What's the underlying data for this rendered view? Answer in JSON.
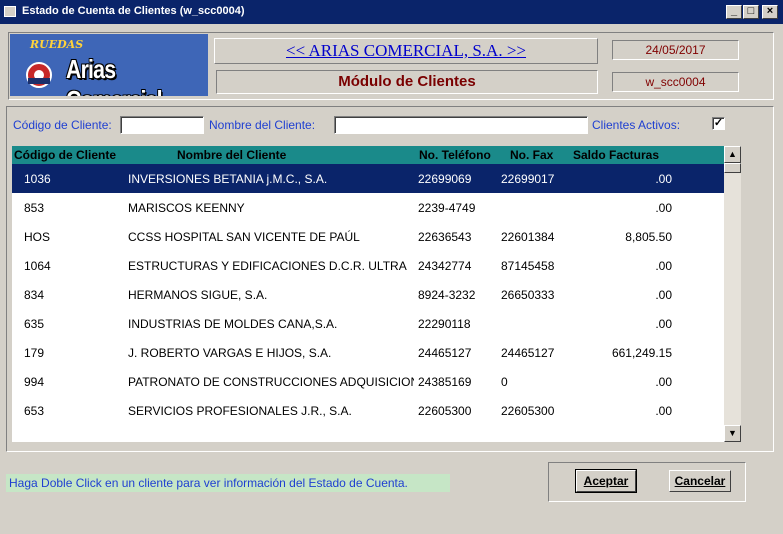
{
  "window": {
    "title": "Estado de Cuenta de Clientes  (w_scc0004)"
  },
  "banner": {
    "logo_top": "RUEDAS",
    "logo_main": "Arias Comercial",
    "company": "<< ARIAS COMERCIAL, S.A. >>",
    "module": "Módulo de Clientes",
    "date": "24/05/2017",
    "window_code": "w_scc0004"
  },
  "filters": {
    "code_label": "Código de Cliente:",
    "code_value": "",
    "name_label": "Nombre del Cliente:",
    "name_value": "",
    "active_label": "Clientes Activos:",
    "active_checked": "✓"
  },
  "grid": {
    "headers": [
      "Código de Cliente",
      "Nombre del Cliente",
      "No. Teléfono",
      "No. Fax",
      "Saldo Facturas"
    ],
    "rows": [
      {
        "code": "1036",
        "name": "INVERSIONES BETANIA j.M.C., S.A.",
        "tel": "22699069",
        "fax": "22699017",
        "saldo": ".00"
      },
      {
        "code": "853",
        "name": " MARISCOS KEENNY",
        "tel": "2239-4749",
        "fax": "",
        "saldo": ".00"
      },
      {
        "code": "HOS",
        "name": "CCSS HOSPITAL SAN VICENTE DE PAÚL",
        "tel": "22636543",
        "fax": "22601384",
        "saldo": "8,805.50"
      },
      {
        "code": "1064",
        "name": "ESTRUCTURAS Y EDIFICACIONES D.C.R. ULTRA",
        "tel": "24342774",
        "fax": "87145458",
        "saldo": ".00"
      },
      {
        "code": "834",
        "name": "HERMANOS SIGUE, S.A.",
        "tel": "8924-3232",
        "fax": "26650333",
        "saldo": ".00"
      },
      {
        "code": "635",
        "name": "INDUSTRIAS DE MOLDES CANA,S.A.",
        "tel": "22290118",
        "fax": "",
        "saldo": ".00"
      },
      {
        "code": "179",
        "name": "J. ROBERTO VARGAS E HIJOS, S.A.",
        "tel": "24465127",
        "fax": "24465127",
        "saldo": "661,249.15"
      },
      {
        "code": "994",
        "name": "PATRONATO DE CONSTRUCCIONES ADQUISICION",
        "tel": "24385169",
        "fax": "0",
        "saldo": ".00"
      },
      {
        "code": "653",
        "name": "SERVICIOS PROFESIONALES  J.R., S.A.",
        "tel": "22605300",
        "fax": "22605300",
        "saldo": ".00"
      }
    ]
  },
  "footer": {
    "hint": "Haga Doble Click en un cliente para ver información del Estado de Cuenta.",
    "accept_label": "Aceptar",
    "cancel_label": "Cancelar"
  },
  "colors": {
    "titlebar": "#0a246a",
    "header_bg": "#1a8a8a",
    "selected_row": "#0a246a",
    "label_blue": "#1f3fd1",
    "module_red": "#7a0000"
  }
}
